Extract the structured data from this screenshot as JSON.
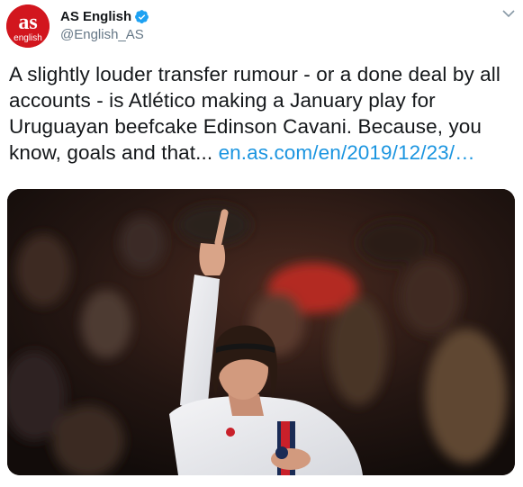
{
  "account": {
    "display_name": "AS English",
    "handle": "@English_AS",
    "avatar_text_top": "as",
    "avatar_text_bottom": "english"
  },
  "tweet": {
    "text_lines": [
      "A slightly louder transfer rumour - or a done deal by all",
      "accounts - is Atlético making a January play for",
      "Uruguayan beefcake Edinson Cavani. Because, you"
    ],
    "last_line_text": "know, goals and that... ",
    "link_text": "en.as.com/en/2019/12/23/…"
  },
  "colors": {
    "brand_red": "#d2161e",
    "link_blue": "#1b95e0",
    "verified_blue": "#1da1f2"
  },
  "icons": {
    "verified": "verified-badge-icon",
    "caret": "chevron-down-icon"
  }
}
